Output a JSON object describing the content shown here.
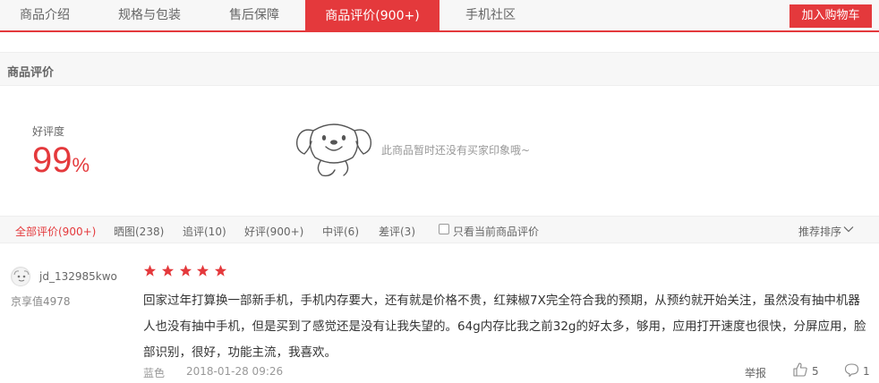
{
  "tabs": [
    {
      "label": "商品介绍",
      "active": false
    },
    {
      "label": "规格与包装",
      "active": false
    },
    {
      "label": "售后保障",
      "active": false
    },
    {
      "label": "商品评价(900+)",
      "active": true
    },
    {
      "label": "手机社区",
      "active": false
    }
  ],
  "cart_button": "加入购物车",
  "section_title": "商品评价",
  "rating": {
    "label": "好评度",
    "value": "99",
    "unit": "%"
  },
  "no_impression_text": "此商品暂时还没有买家印象哦~",
  "filters": [
    {
      "label": "全部评价(900+)",
      "active": true
    },
    {
      "label": "晒图(238)",
      "active": false
    },
    {
      "label": "追评(10)",
      "active": false
    },
    {
      "label": "好评(900+)",
      "active": false
    },
    {
      "label": "中评(6)",
      "active": false
    },
    {
      "label": "差评(3)",
      "active": false
    }
  ],
  "current_only_label": "只看当前商品评价",
  "sort_label": "推荐排序",
  "review": {
    "username": "jd_132985kwo",
    "user_level": "京享值4978",
    "stars": 5,
    "text": "回家过年打算换一部新手机，手机内存要大，还有就是价格不贵，红辣椒7X完全符合我的预期，从预约就开始关注，虽然没有抽中机器人也没有抽中手机，但是买到了感觉还是没有让我失望的。64g内存比我之前32g的好太多，够用，应用打开速度也很快，分屏应用，脸部识别，很好，功能主流，我喜欢。",
    "color": "蓝色",
    "date": "2018-01-28 09:26",
    "report_label": "举报",
    "likes": "5",
    "replies": "1"
  },
  "colors": {
    "accent": "#e4393c",
    "star": "#e4393c"
  }
}
